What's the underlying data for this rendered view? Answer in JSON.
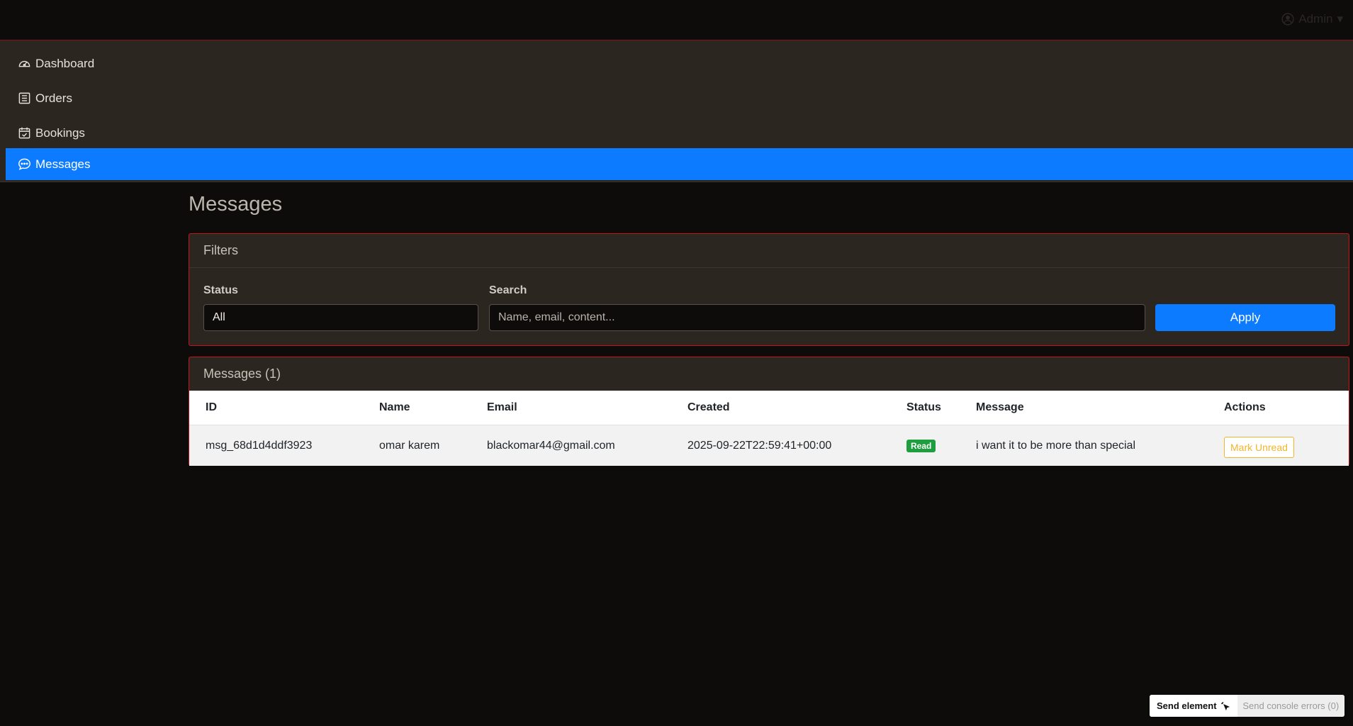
{
  "header": {
    "user_label": "Admin"
  },
  "sidebar": {
    "items": [
      {
        "label": "Dashboard",
        "icon": "speedometer-icon",
        "active": false
      },
      {
        "label": "Orders",
        "icon": "receipt-icon",
        "active": false
      },
      {
        "label": "Bookings",
        "icon": "calendar-check-icon",
        "active": false
      },
      {
        "label": "Messages",
        "icon": "chat-dots-icon",
        "active": true
      }
    ]
  },
  "page": {
    "title": "Messages"
  },
  "filters": {
    "title": "Filters",
    "status_label": "Status",
    "status_value": "All",
    "search_label": "Search",
    "search_placeholder": "Name, email, content...",
    "apply_label": "Apply"
  },
  "messages": {
    "title": "Messages (1)",
    "columns": [
      "ID",
      "Name",
      "Email",
      "Created",
      "Status",
      "Message",
      "Actions"
    ],
    "rows": [
      {
        "id": "msg_68d1d4ddf3923",
        "name": "omar karem",
        "email": "blackomar44@gmail.com",
        "created": "2025-09-22T22:59:41+00:00",
        "status": "Read",
        "message": "i want it to be more than special",
        "action": "Mark Unread"
      }
    ]
  },
  "devtools": {
    "send_element": "Send element",
    "send_errors": "Send console errors (0)"
  },
  "colors": {
    "accent": "#0d7bff",
    "card_border": "#c1161b",
    "badge_read": "#1e9e3e",
    "warning": "#f0b52b"
  }
}
